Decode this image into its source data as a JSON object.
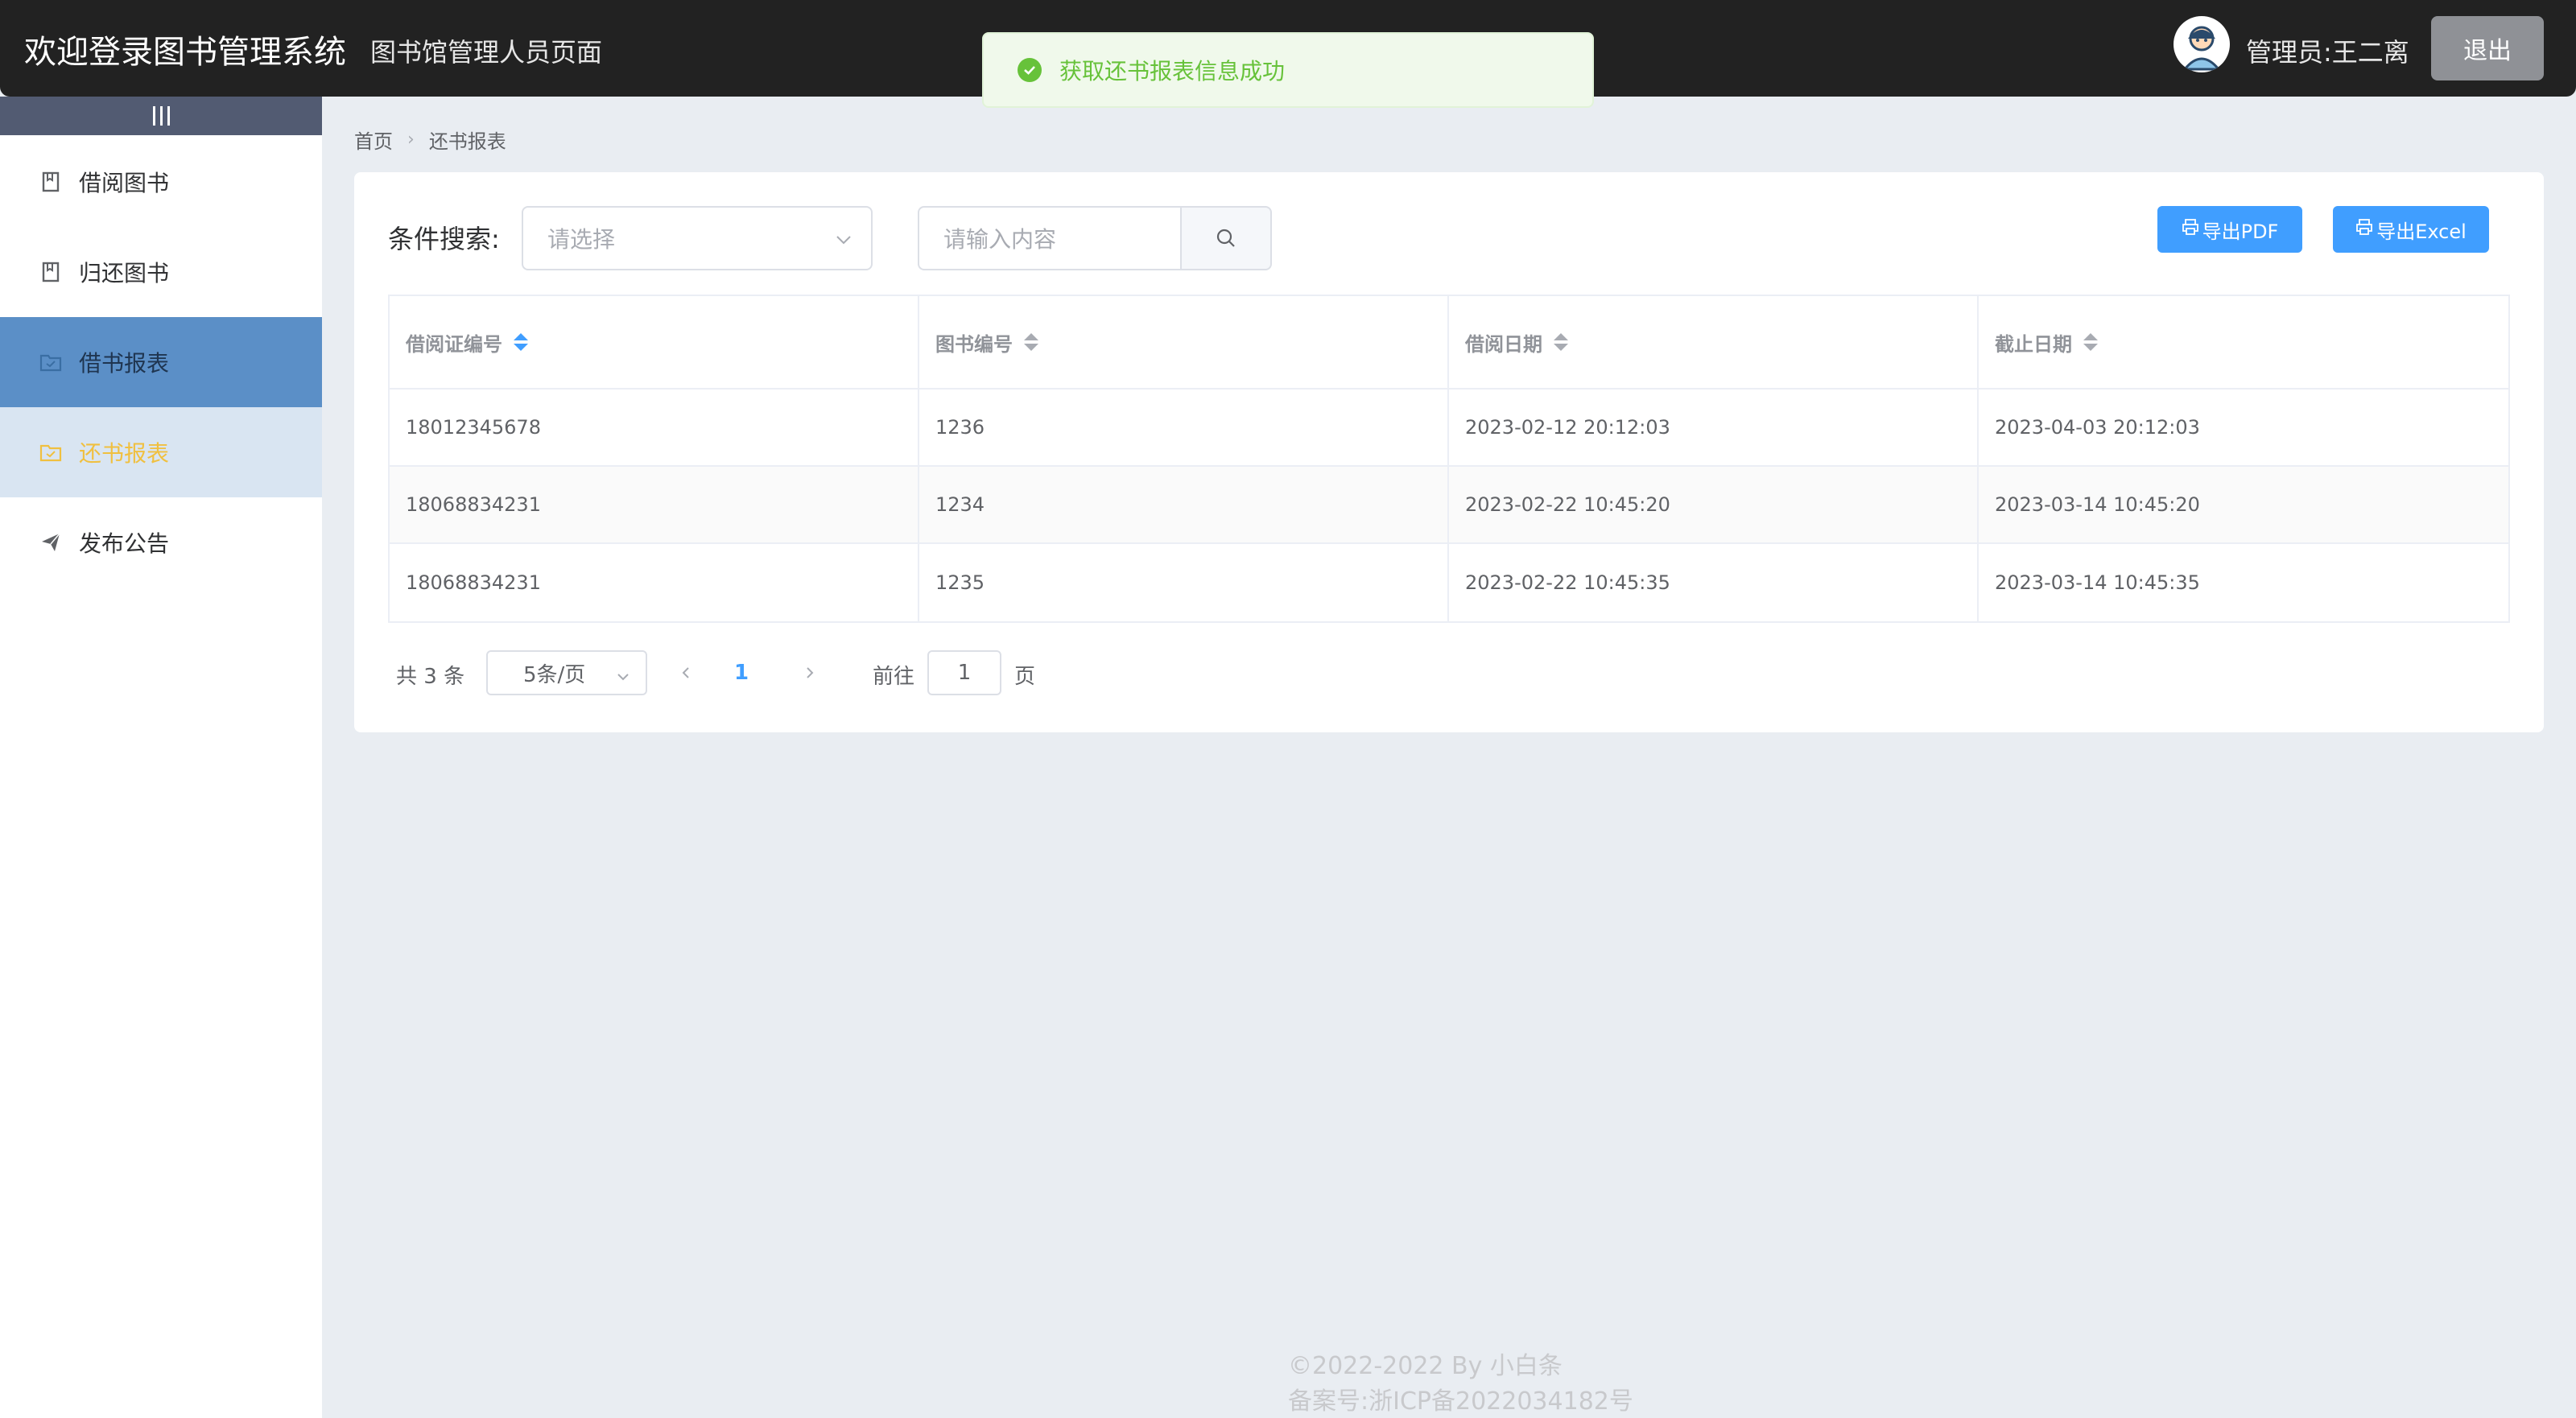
{
  "header": {
    "title": "欢迎登录图书管理系统",
    "subtitle": "图书馆管理人员页面",
    "admin": "管理员:王二离",
    "logout": "退出"
  },
  "toast": {
    "message": "获取还书报表信息成功",
    "color": "#67c23a"
  },
  "sidebar": {
    "items": [
      {
        "label": "借阅图书",
        "icon": "book-icon"
      },
      {
        "label": "归还图书",
        "icon": "book-icon"
      },
      {
        "label": "借书报表",
        "icon": "folder-icon"
      },
      {
        "label": "还书报表",
        "icon": "folder-icon"
      },
      {
        "label": "发布公告",
        "icon": "send-icon"
      }
    ]
  },
  "breadcrumb": {
    "home": "首页",
    "current": "还书报表"
  },
  "search": {
    "label": "条件搜索:",
    "select_placeholder": "请选择",
    "input_placeholder": "请输入内容"
  },
  "toolbar": {
    "export_pdf": "导出PDF",
    "export_excel": "导出Excel"
  },
  "table": {
    "columns": [
      "借阅证编号",
      "图书编号",
      "借阅日期",
      "截止日期"
    ],
    "rows": [
      [
        "18012345678",
        "1236",
        "2023-02-12 20:12:03",
        "2023-04-03 20:12:03"
      ],
      [
        "18068834231",
        "1234",
        "2023-02-22 10:45:20",
        "2023-03-14 10:45:20"
      ],
      [
        "18068834231",
        "1235",
        "2023-02-22 10:45:35",
        "2023-03-14 10:45:35"
      ]
    ]
  },
  "pagination": {
    "total": "共 3 条",
    "page_size": "5条/页",
    "current_page": "1",
    "goto_label": "前往",
    "goto_value": "1",
    "page_suffix": "页"
  },
  "footer": {
    "copyright": "©2022-2022 By 小白条",
    "icp": "备案号:浙ICP备2022034182号"
  },
  "colors": {
    "primary": "#409eff",
    "header_bg": "#222222",
    "active_menu": "#5b8fc7"
  }
}
